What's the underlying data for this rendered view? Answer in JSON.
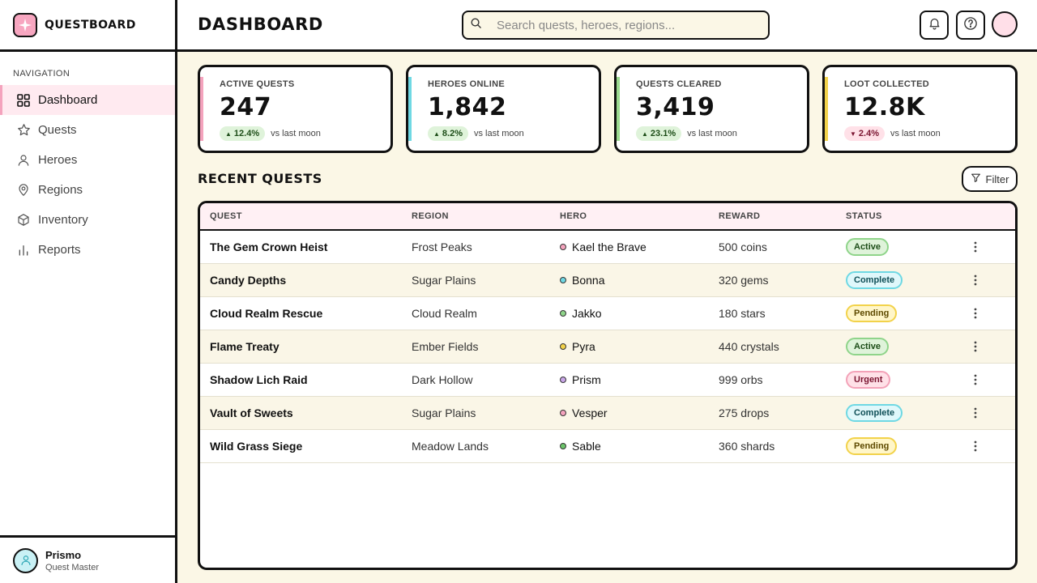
{
  "app": {
    "name": "QUESTBOARD"
  },
  "sidebar": {
    "heading": "NAVIGATION",
    "items": [
      {
        "label": "Dashboard",
        "icon": "grid-icon",
        "active": true
      },
      {
        "label": "Quests",
        "icon": "star-icon"
      },
      {
        "label": "Heroes",
        "icon": "person-icon"
      },
      {
        "label": "Regions",
        "icon": "map-pin-icon"
      },
      {
        "label": "Inventory",
        "icon": "box-icon"
      },
      {
        "label": "Reports",
        "icon": "bar-chart-icon"
      }
    ],
    "user": {
      "name": "Prismo",
      "role": "Quest Master"
    }
  },
  "header": {
    "title": "DASHBOARD",
    "search_placeholder": "Search quests, heroes, regions..."
  },
  "stats": [
    {
      "label": "ACTIVE QUESTS",
      "value": "247",
      "delta": "12.4%",
      "direction": "up",
      "note": "vs last moon",
      "color": "#f4a3bd"
    },
    {
      "label": "HEROES ONLINE",
      "value": "1,842",
      "delta": "8.2%",
      "direction": "up",
      "note": "vs last moon",
      "color": "#6fd8e3"
    },
    {
      "label": "QUESTS CLEARED",
      "value": "3,419",
      "delta": "23.1%",
      "direction": "up",
      "note": "vs last moon",
      "color": "#9ad98f"
    },
    {
      "label": "LOOT COLLECTED",
      "value": "12.8K",
      "delta": "2.4%",
      "direction": "down",
      "note": "vs last moon",
      "color": "#f2d24a"
    }
  ],
  "recent": {
    "title": "RECENT QUESTS",
    "filter_label": "Filter",
    "columns": [
      "QUEST",
      "REGION",
      "HERO",
      "REWARD",
      "STATUS"
    ],
    "rows": [
      {
        "quest": "The Gem Crown Heist",
        "region": "Frost Peaks",
        "hero": "Kael the Brave",
        "hero_color": "#f4a3bd",
        "reward": "500 coins",
        "status": "Active"
      },
      {
        "quest": "Candy Depths",
        "region": "Sugar Plains",
        "hero": "Bonna",
        "hero_color": "#6fd8e3",
        "reward": "320 gems",
        "status": "Complete"
      },
      {
        "quest": "Cloud Realm Rescue",
        "region": "Cloud Realm",
        "hero": "Jakko",
        "hero_color": "#8fd48a",
        "reward": "180 stars",
        "status": "Pending"
      },
      {
        "quest": "Flame Treaty",
        "region": "Ember Fields",
        "hero": "Pyra",
        "hero_color": "#f2d24a",
        "reward": "440 crystals",
        "status": "Active"
      },
      {
        "quest": "Shadow Lich Raid",
        "region": "Dark Hollow",
        "hero": "Prism",
        "hero_color": "#c9a6e8",
        "reward": "999 orbs",
        "status": "Urgent"
      },
      {
        "quest": "Vault of Sweets",
        "region": "Sugar Plains",
        "hero": "Vesper",
        "hero_color": "#f4a3bd",
        "reward": "275 drops",
        "status": "Complete"
      },
      {
        "quest": "Wild Grass Siege",
        "region": "Meadow Lands",
        "hero": "Sable",
        "hero_color": "#6cc46a",
        "reward": "360 shards",
        "status": "Pending"
      }
    ]
  }
}
